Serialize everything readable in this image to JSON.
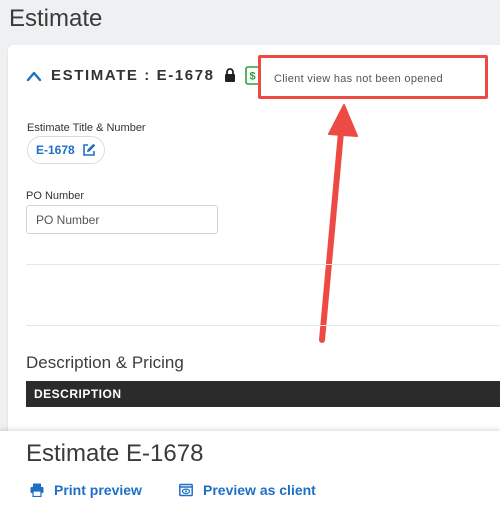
{
  "page": {
    "title": "Estimate"
  },
  "estimate_header": {
    "label": "ESTIMATE : E-1678"
  },
  "client_view": {
    "status": "Client view has not been opened"
  },
  "fields": {
    "title_label": "Estimate Title & Number",
    "title_value": "E-1678",
    "po_label": "PO Number",
    "po_placeholder": "PO Number"
  },
  "pricing": {
    "section_title": "Description & Pricing",
    "column_header": "DESCRIPTION"
  },
  "footer": {
    "title": "Estimate E-1678",
    "print_preview": "Print preview",
    "preview_as_client": "Preview as client"
  },
  "colors": {
    "accent": "#1f6fc7",
    "highlight": "#ee4a44",
    "money_icon": "#2e9e3e"
  },
  "icons": [
    "chevron-up-icon",
    "lock-icon",
    "money-icon",
    "edit-icon",
    "printer-icon",
    "preview-icon"
  ]
}
